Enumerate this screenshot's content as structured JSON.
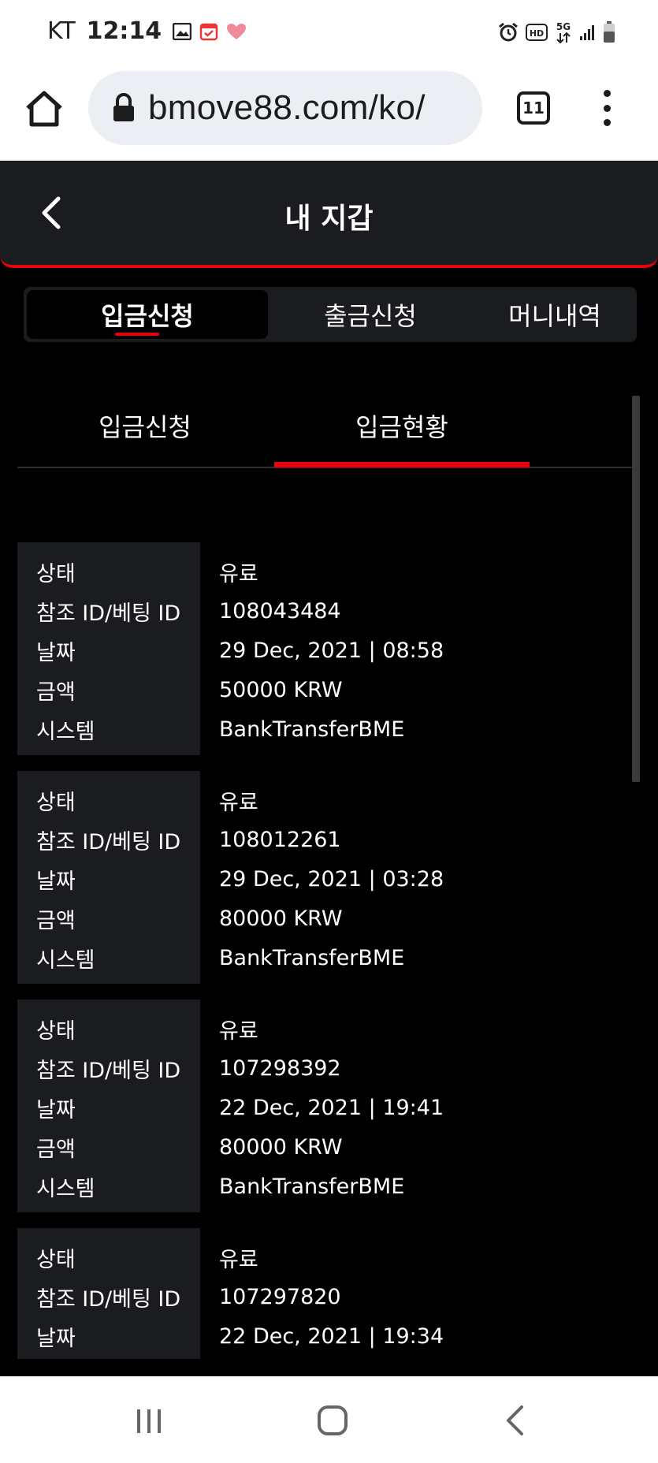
{
  "status_bar": {
    "carrier": "KT",
    "time": "12:14"
  },
  "browser": {
    "url": "bmove88.com/ko/",
    "tab_count": "11"
  },
  "header": {
    "title": "내 지갑"
  },
  "main_tabs": [
    {
      "label": "입금신청",
      "active": true
    },
    {
      "label": "출금신청",
      "active": false
    },
    {
      "label": "머니내역",
      "active": false
    }
  ],
  "sub_tabs": [
    {
      "label": "입금신청",
      "active": false
    },
    {
      "label": "입금현황",
      "active": true
    }
  ],
  "labels": {
    "status": "상태",
    "ref_id": "참조 ID/베팅 ID",
    "date": "날짜",
    "amount": "금액",
    "system": "시스템"
  },
  "records": [
    {
      "status": "유료",
      "ref_id": "108043484",
      "date": "29 Dec, 2021 | 08:58",
      "amount": "50000 KRW",
      "system": "BankTransferBME"
    },
    {
      "status": "유료",
      "ref_id": "108012261",
      "date": "29 Dec, 2021 | 03:28",
      "amount": "80000 KRW",
      "system": "BankTransferBME"
    },
    {
      "status": "유료",
      "ref_id": "107298392",
      "date": "22 Dec, 2021 | 19:41",
      "amount": "80000 KRW",
      "system": "BankTransferBME"
    },
    {
      "status": "유료",
      "ref_id": "107297820",
      "date": "22 Dec, 2021 | 19:34"
    }
  ],
  "colors": {
    "accent": "#e8000b",
    "panel": "#1b1c20",
    "background": "#000000"
  }
}
